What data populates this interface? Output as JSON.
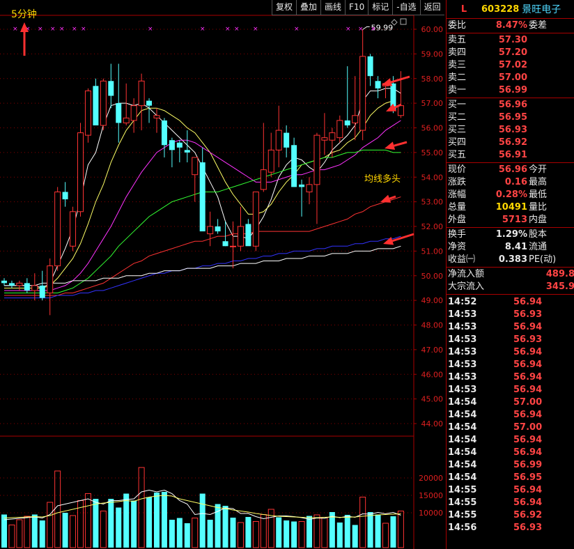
{
  "period_label": "5分钟",
  "ma_note": "均线多头",
  "toolbar": [
    "复权",
    "叠加",
    "画线",
    "F10",
    "标记",
    "-自选",
    "返回"
  ],
  "high_marker": "59.99",
  "price_axis": [
    "60.00",
    "59.00",
    "58.00",
    "57.00",
    "56.00",
    "55.00",
    "54.00",
    "53.00",
    "52.00",
    "51.00",
    "50.00",
    "49.00",
    "48.00",
    "47.00",
    "46.00",
    "45.00",
    "44.00"
  ],
  "volume_axis": [
    "20000",
    "15000",
    "10000"
  ],
  "colors": {
    "up": "#ff3333",
    "down": "#54ffff",
    "ma5": "#ffffff",
    "ma10": "#ffff66",
    "ma20": "#ff33ff",
    "ma30": "#33ff33",
    "ma60": "#ff3333",
    "ma120": "#3333ff",
    "ma250": "#ffffff"
  },
  "chart_data": {
    "type": "candlestick",
    "ylim": [
      43.5,
      60.6
    ],
    "candles": [
      [
        49.8,
        49.9,
        49.6,
        49.7
      ],
      [
        49.7,
        49.8,
        49.5,
        49.6
      ],
      [
        49.6,
        49.8,
        49.4,
        49.7
      ],
      [
        49.7,
        49.9,
        49.3,
        49.4
      ],
      [
        49.4,
        50.1,
        49.0,
        49.6
      ],
      [
        49.6,
        50.2,
        49.0,
        49.1
      ],
      [
        49.3,
        50.7,
        48.4,
        50.4
      ],
      [
        50.4,
        53.6,
        50.2,
        53.4
      ],
      [
        53.4,
        53.8,
        52.8,
        53.1
      ],
      [
        51.2,
        52.8,
        51.0,
        52.6
      ],
      [
        52.6,
        56.2,
        52.4,
        55.8
      ],
      [
        55.7,
        57.6,
        55.4,
        57.5
      ],
      [
        57.7,
        58.0,
        56.2,
        56.1
      ],
      [
        56.1,
        58.0,
        55.9,
        57.9
      ],
      [
        57.9,
        58.6,
        56.8,
        57.3
      ],
      [
        57.0,
        58.6,
        55.4,
        56.2
      ],
      [
        56.2,
        57.8,
        56.1,
        56.4
      ],
      [
        56.3,
        57.2,
        55.8,
        56.9
      ],
      [
        56.9,
        58.2,
        55.9,
        57.9
      ],
      [
        57.1,
        57.2,
        56.2,
        56.9
      ],
      [
        56.4,
        56.8,
        55.8,
        56.5
      ],
      [
        56.3,
        56.4,
        54.8,
        55.3
      ],
      [
        55.5,
        55.6,
        54.4,
        55.1
      ],
      [
        55.4,
        55.5,
        54.6,
        55.2
      ],
      [
        55.1,
        55.9,
        54.6,
        55.0
      ],
      [
        54.1,
        54.8,
        53.0,
        54.8
      ],
      [
        54.6,
        55.2,
        51.9,
        51.8
      ],
      [
        51.7,
        52.6,
        51.2,
        52.0
      ],
      [
        52.0,
        52.3,
        51.7,
        51.8
      ],
      [
        51.4,
        52.2,
        51.2,
        51.2
      ],
      [
        51.2,
        52.2,
        50.3,
        51.2
      ],
      [
        51.2,
        52.8,
        51.0,
        52.0
      ],
      [
        52.1,
        52.3,
        51.6,
        51.2
      ],
      [
        51.2,
        52.9,
        51.0,
        53.4
      ],
      [
        53.5,
        56.2,
        53.4,
        54.3
      ],
      [
        54.2,
        55.8,
        54.0,
        55.1
      ],
      [
        55.1,
        56.9,
        54.4,
        55.9
      ],
      [
        55.8,
        56.1,
        54.8,
        55.2
      ],
      [
        55.3,
        55.6,
        53.6,
        53.6
      ],
      [
        53.7,
        53.9,
        52.4,
        53.6
      ],
      [
        53.4,
        54.0,
        52.9,
        53.7
      ],
      [
        53.7,
        55.8,
        52.1,
        55.7
      ],
      [
        55.5,
        56.6,
        54.9,
        55.6
      ],
      [
        55.5,
        56.0,
        54.8,
        55.8
      ],
      [
        55.6,
        56.5,
        55.4,
        56.3
      ],
      [
        56.3,
        58.5,
        56.0,
        56.1
      ],
      [
        56.2,
        58.1,
        55.5,
        56.5
      ],
      [
        55.9,
        59.99,
        55.5,
        58.9
      ],
      [
        58.9,
        59.0,
        57.7,
        58.1
      ],
      [
        57.9,
        58.1,
        57.2,
        57.6
      ],
      [
        57.7,
        57.8,
        57.2,
        57.8
      ],
      [
        57.8,
        58.1,
        56.6,
        56.7
      ],
      [
        56.5,
        58.3,
        56.4,
        56.9
      ]
    ],
    "volume_ylim": [
      0,
      30000
    ],
    "volume": [
      [
        9500,
        "d"
      ],
      [
        6500,
        "u"
      ],
      [
        8000,
        "u"
      ],
      [
        9000,
        "u"
      ],
      [
        9500,
        "d"
      ],
      [
        7800,
        "d"
      ],
      [
        13000,
        "u"
      ],
      [
        22000,
        "u"
      ],
      [
        10000,
        "d"
      ],
      [
        9200,
        "u"
      ],
      [
        13500,
        "u"
      ],
      [
        15500,
        "u"
      ],
      [
        14000,
        "d"
      ],
      [
        10500,
        "u"
      ],
      [
        14000,
        "d"
      ],
      [
        11500,
        "d"
      ],
      [
        15500,
        "d"
      ],
      [
        13500,
        "d"
      ],
      [
        23000,
        "u"
      ],
      [
        14500,
        "d"
      ],
      [
        15800,
        "d"
      ],
      [
        16000,
        "d"
      ],
      [
        8000,
        "d"
      ],
      [
        8500,
        "d"
      ],
      [
        7000,
        "d"
      ],
      [
        8500,
        "u"
      ],
      [
        15500,
        "d"
      ],
      [
        8000,
        "d"
      ],
      [
        12500,
        "d"
      ],
      [
        12000,
        "d"
      ],
      [
        8600,
        "d"
      ],
      [
        7200,
        "u"
      ],
      [
        8800,
        "d"
      ],
      [
        7500,
        "u"
      ],
      [
        9500,
        "u"
      ],
      [
        11000,
        "u"
      ],
      [
        8700,
        "d"
      ],
      [
        7800,
        "d"
      ],
      [
        7500,
        "d"
      ],
      [
        7500,
        "u"
      ],
      [
        9100,
        "d"
      ],
      [
        9400,
        "u"
      ],
      [
        8700,
        "u"
      ],
      [
        10200,
        "d"
      ],
      [
        7200,
        "d"
      ],
      [
        9400,
        "d"
      ],
      [
        6500,
        "d"
      ],
      [
        14500,
        "u"
      ],
      [
        10200,
        "d"
      ],
      [
        9500,
        "d"
      ],
      [
        7000,
        "u"
      ],
      [
        9000,
        "d"
      ],
      [
        10500,
        "u"
      ]
    ],
    "ma_series": [
      {
        "name": "ma5",
        "values": [
          49.6,
          49.6,
          49.6,
          49.6,
          49.6,
          49.5,
          49.7,
          50.4,
          51.1,
          51.9,
          53.1,
          54.5,
          55.0,
          56.1,
          56.9,
          57.0,
          57.0,
          56.9,
          57.0,
          56.8,
          56.5,
          56.2,
          55.9,
          55.6,
          55.3,
          55.0,
          54.4,
          53.8,
          53.2,
          52.2,
          51.6,
          51.6,
          51.5,
          51.9,
          52.4,
          53.1,
          54.0,
          54.5,
          54.8,
          54.7,
          54.4,
          54.2,
          54.6,
          55.1,
          55.4,
          55.7,
          56.1,
          57.1,
          57.5,
          57.5,
          57.6,
          57.6,
          57.4
        ]
      },
      {
        "name": "ma10",
        "values": [
          49.5,
          49.5,
          49.5,
          49.5,
          49.5,
          49.5,
          49.6,
          49.9,
          50.3,
          50.7,
          51.3,
          52.1,
          53.0,
          53.7,
          54.6,
          55.3,
          55.9,
          56.3,
          56.7,
          56.8,
          56.8,
          56.7,
          56.5,
          56.3,
          56.0,
          55.8,
          55.4,
          55.0,
          54.4,
          53.8,
          53.3,
          52.9,
          52.5,
          52.5,
          52.6,
          52.9,
          53.4,
          53.8,
          54.1,
          54.5,
          54.6,
          54.7,
          54.8,
          55.0,
          55.1,
          55.4,
          55.6,
          56.0,
          56.5,
          56.8,
          57.0,
          57.1
        ]
      },
      {
        "name": "ma20",
        "values": [
          49.4,
          49.4,
          49.4,
          49.4,
          49.4,
          49.4,
          49.4,
          49.5,
          49.6,
          49.8,
          50.1,
          50.5,
          51.0,
          51.5,
          52.0,
          52.6,
          53.2,
          53.7,
          54.2,
          54.6,
          55.0,
          55.2,
          55.4,
          55.5,
          55.5,
          55.4,
          55.2,
          55.0,
          54.8,
          54.6,
          54.4,
          54.2,
          54.0,
          53.8,
          53.8,
          53.8,
          53.9,
          54.0,
          54.1,
          54.1,
          54.2,
          54.3,
          54.3,
          54.4,
          54.5,
          54.7,
          54.9,
          55.2,
          55.4,
          55.6,
          55.9,
          56.1,
          56.3
        ]
      },
      {
        "name": "ma30",
        "values": [
          49.3,
          49.3,
          49.3,
          49.3,
          49.3,
          49.3,
          49.3,
          49.3,
          49.4,
          49.5,
          49.7,
          49.9,
          50.2,
          50.5,
          50.8,
          51.2,
          51.5,
          51.8,
          52.1,
          52.4,
          52.6,
          52.8,
          53.0,
          53.1,
          53.2,
          53.3,
          53.4,
          53.4,
          53.4,
          53.5,
          53.6,
          53.7,
          53.8,
          53.9,
          54.0,
          54.1,
          54.2,
          54.3,
          54.4,
          54.5,
          54.6,
          54.7,
          54.8,
          54.8,
          54.9,
          55.0,
          55.0,
          55.1,
          55.1,
          55.1,
          55.1,
          55.0,
          55.0
        ]
      },
      {
        "name": "ma60",
        "values": [
          49.2,
          49.2,
          49.2,
          49.2,
          49.2,
          49.2,
          49.2,
          49.2,
          49.3,
          49.3,
          49.4,
          49.5,
          49.6,
          49.7,
          49.9,
          50.1,
          50.3,
          50.5,
          50.6,
          50.8,
          50.9,
          51.0,
          51.1,
          51.2,
          51.3,
          51.4,
          51.4,
          51.5,
          51.6,
          51.6,
          51.7,
          51.7,
          51.7,
          51.8,
          51.8,
          51.8,
          51.8,
          51.8,
          51.8,
          51.8,
          51.8,
          51.9,
          52.0,
          52.1,
          52.2,
          52.3,
          52.5,
          52.6,
          52.8,
          52.9,
          53.0,
          53.1,
          53.2
        ]
      },
      {
        "name": "ma120",
        "values": [
          49.1,
          49.1,
          49.1,
          49.1,
          49.1,
          49.1,
          49.1,
          49.2,
          49.2,
          49.2,
          49.3,
          49.3,
          49.4,
          49.4,
          49.5,
          49.6,
          49.7,
          49.8,
          49.9,
          50.0,
          50.1,
          50.1,
          50.2,
          50.2,
          50.3,
          50.3,
          50.4,
          50.4,
          50.5,
          50.5,
          50.6,
          50.6,
          50.7,
          50.7,
          50.8,
          50.8,
          50.9,
          50.9,
          51.0,
          51.0,
          51.0,
          51.1,
          51.1,
          51.2,
          51.2,
          51.2,
          51.3,
          51.3,
          51.4,
          51.4,
          51.5,
          51.5,
          51.6
        ]
      },
      {
        "name": "ma250",
        "values": [
          49.6,
          49.6,
          49.6,
          49.6,
          49.6,
          49.7,
          49.7,
          49.7,
          49.7,
          49.8,
          49.8,
          49.8,
          49.8,
          49.9,
          49.9,
          49.9,
          50.0,
          50.0,
          50.0,
          50.1,
          50.1,
          50.2,
          50.2,
          50.2,
          50.3,
          50.3,
          50.3,
          50.3,
          50.4,
          50.4,
          50.4,
          50.5,
          50.5,
          50.5,
          50.6,
          50.6,
          50.6,
          50.7,
          50.7,
          50.7,
          50.8,
          50.8,
          50.8,
          50.9,
          50.9,
          50.9,
          51.0,
          51.0,
          51.0,
          51.1,
          51.1,
          51.1,
          51.2
        ]
      }
    ],
    "vol_ma_series": [
      {
        "name": "vma5",
        "values": [
          8000,
          8200,
          8400,
          8600,
          8800,
          8500,
          9500,
          12000,
          12500,
          13000,
          13500,
          14000,
          13000,
          12500,
          13500,
          13500,
          13800,
          14000,
          16000,
          16500,
          16000,
          16500,
          15500,
          13500,
          12500,
          9500,
          9800,
          9500,
          10400,
          11400,
          11200,
          9800,
          9800,
          8900,
          8300,
          8700,
          9100,
          9100,
          8900,
          8600,
          8100,
          8500,
          8400,
          9000,
          8600,
          9000,
          8700,
          9700,
          9600,
          10100,
          9700,
          10100,
          9300
        ]
      },
      {
        "name": "vma10",
        "values": [
          8500,
          8600,
          8700,
          8800,
          8900,
          8800,
          9200,
          10000,
          10500,
          11000,
          11500,
          12000,
          12500,
          12800,
          13000,
          13200,
          13500,
          13300,
          14000,
          14500,
          14800,
          15000,
          14800,
          14000,
          13500,
          13000,
          12500,
          12000,
          11500,
          11200,
          10800,
          10500,
          10200,
          9800,
          9500,
          9200,
          9000,
          8900,
          8800,
          8700,
          8600,
          8600,
          8700,
          8800,
          8700,
          8700,
          8800,
          9000,
          9200,
          9400,
          9500,
          9600,
          9700
        ]
      }
    ],
    "ma_note_arrows": true
  },
  "stock": {
    "marker": "L",
    "code": "603228",
    "name": "景旺电子"
  },
  "order_ratio": {
    "label": "委比",
    "value": "8.47%",
    "label2": "委差"
  },
  "asks": [
    {
      "label": "卖五",
      "price": "57.30"
    },
    {
      "label": "卖四",
      "price": "57.20"
    },
    {
      "label": "卖三",
      "price": "57.02"
    },
    {
      "label": "卖二",
      "price": "57.00"
    },
    {
      "label": "卖一",
      "price": "56.99"
    }
  ],
  "bids": [
    {
      "label": "买一",
      "price": "56.96"
    },
    {
      "label": "买二",
      "price": "56.95"
    },
    {
      "label": "买三",
      "price": "56.93"
    },
    {
      "label": "买四",
      "price": "56.92"
    },
    {
      "label": "买五",
      "price": "56.91"
    }
  ],
  "quote": [
    {
      "label": "现价",
      "value": "56.96",
      "label2": "今开",
      "color": "red"
    },
    {
      "label": "涨跌",
      "value": "0.16",
      "label2": "最高",
      "color": "red"
    },
    {
      "label": "涨幅",
      "value": "0.28%",
      "label2": "最低",
      "color": "red"
    },
    {
      "label": "总量",
      "value": "10491",
      "label2": "量比",
      "color": "yel"
    },
    {
      "label": "外盘",
      "value": "5713",
      "label2": "内盘",
      "color": "red"
    }
  ],
  "stats": [
    {
      "label": "换手",
      "value": "1.29%",
      "label2": "股本"
    },
    {
      "label": "净资",
      "value": "8.41",
      "label2": "流通"
    },
    {
      "label": "收益㈠",
      "value": "0.383",
      "label2": "PE(动)"
    }
  ],
  "flows": [
    {
      "label": "净流入额",
      "value": "489.8"
    },
    {
      "label": "大宗流入",
      "value": "345.9"
    }
  ],
  "ticks": [
    {
      "time": "14:52",
      "price": "56.94"
    },
    {
      "time": "14:53",
      "price": "56.93"
    },
    {
      "time": "14:53",
      "price": "56.94"
    },
    {
      "time": "14:53",
      "price": "56.93"
    },
    {
      "time": "14:53",
      "price": "56.94"
    },
    {
      "time": "14:53",
      "price": "56.94"
    },
    {
      "time": "14:53",
      "price": "56.94"
    },
    {
      "time": "14:53",
      "price": "56.94"
    },
    {
      "time": "14:54",
      "price": "57.00"
    },
    {
      "time": "14:54",
      "price": "56.94"
    },
    {
      "time": "14:54",
      "price": "57.00"
    },
    {
      "time": "14:54",
      "price": "56.94"
    },
    {
      "time": "14:54",
      "price": "56.94"
    },
    {
      "time": "14:54",
      "price": "56.99"
    },
    {
      "time": "14:54",
      "price": "56.95"
    },
    {
      "time": "14:55",
      "price": "56.94"
    },
    {
      "time": "14:55",
      "price": "56.94"
    },
    {
      "time": "14:55",
      "price": "56.92"
    },
    {
      "time": "14:56",
      "price": "56.93"
    }
  ]
}
